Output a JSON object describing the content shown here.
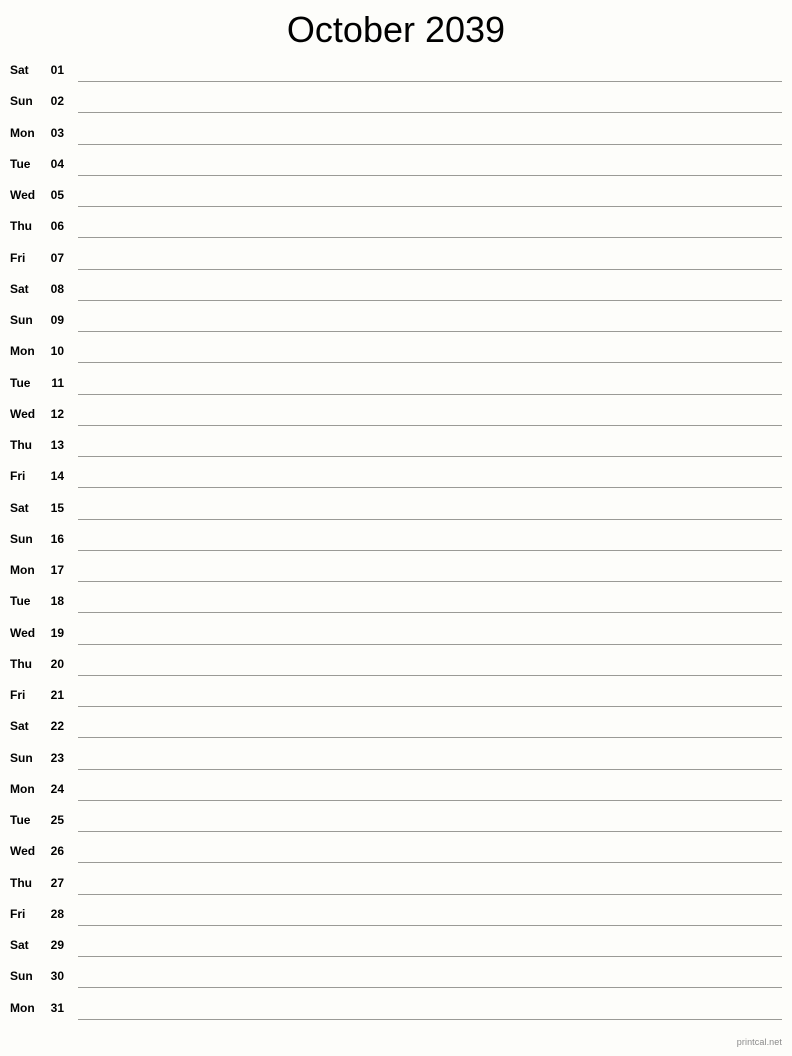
{
  "header": {
    "title": "October 2039",
    "month": "October",
    "year": "2039"
  },
  "footer": {
    "credit": "printcal.net"
  },
  "colors": {
    "page_background": "#fdfdfa",
    "title_text": "#000000",
    "row_text": "#000000",
    "writing_line": "#9a9a96",
    "footer_text": "#8a8a8a"
  },
  "calendar": {
    "layout": "single-column-notes",
    "days": [
      {
        "weekday": "Sat",
        "number": "01"
      },
      {
        "weekday": "Sun",
        "number": "02"
      },
      {
        "weekday": "Mon",
        "number": "03"
      },
      {
        "weekday": "Tue",
        "number": "04"
      },
      {
        "weekday": "Wed",
        "number": "05"
      },
      {
        "weekday": "Thu",
        "number": "06"
      },
      {
        "weekday": "Fri",
        "number": "07"
      },
      {
        "weekday": "Sat",
        "number": "08"
      },
      {
        "weekday": "Sun",
        "number": "09"
      },
      {
        "weekday": "Mon",
        "number": "10"
      },
      {
        "weekday": "Tue",
        "number": "11"
      },
      {
        "weekday": "Wed",
        "number": "12"
      },
      {
        "weekday": "Thu",
        "number": "13"
      },
      {
        "weekday": "Fri",
        "number": "14"
      },
      {
        "weekday": "Sat",
        "number": "15"
      },
      {
        "weekday": "Sun",
        "number": "16"
      },
      {
        "weekday": "Mon",
        "number": "17"
      },
      {
        "weekday": "Tue",
        "number": "18"
      },
      {
        "weekday": "Wed",
        "number": "19"
      },
      {
        "weekday": "Thu",
        "number": "20"
      },
      {
        "weekday": "Fri",
        "number": "21"
      },
      {
        "weekday": "Sat",
        "number": "22"
      },
      {
        "weekday": "Sun",
        "number": "23"
      },
      {
        "weekday": "Mon",
        "number": "24"
      },
      {
        "weekday": "Tue",
        "number": "25"
      },
      {
        "weekday": "Wed",
        "number": "26"
      },
      {
        "weekday": "Thu",
        "number": "27"
      },
      {
        "weekday": "Fri",
        "number": "28"
      },
      {
        "weekday": "Sat",
        "number": "29"
      },
      {
        "weekday": "Sun",
        "number": "30"
      },
      {
        "weekday": "Mon",
        "number": "31"
      }
    ]
  }
}
